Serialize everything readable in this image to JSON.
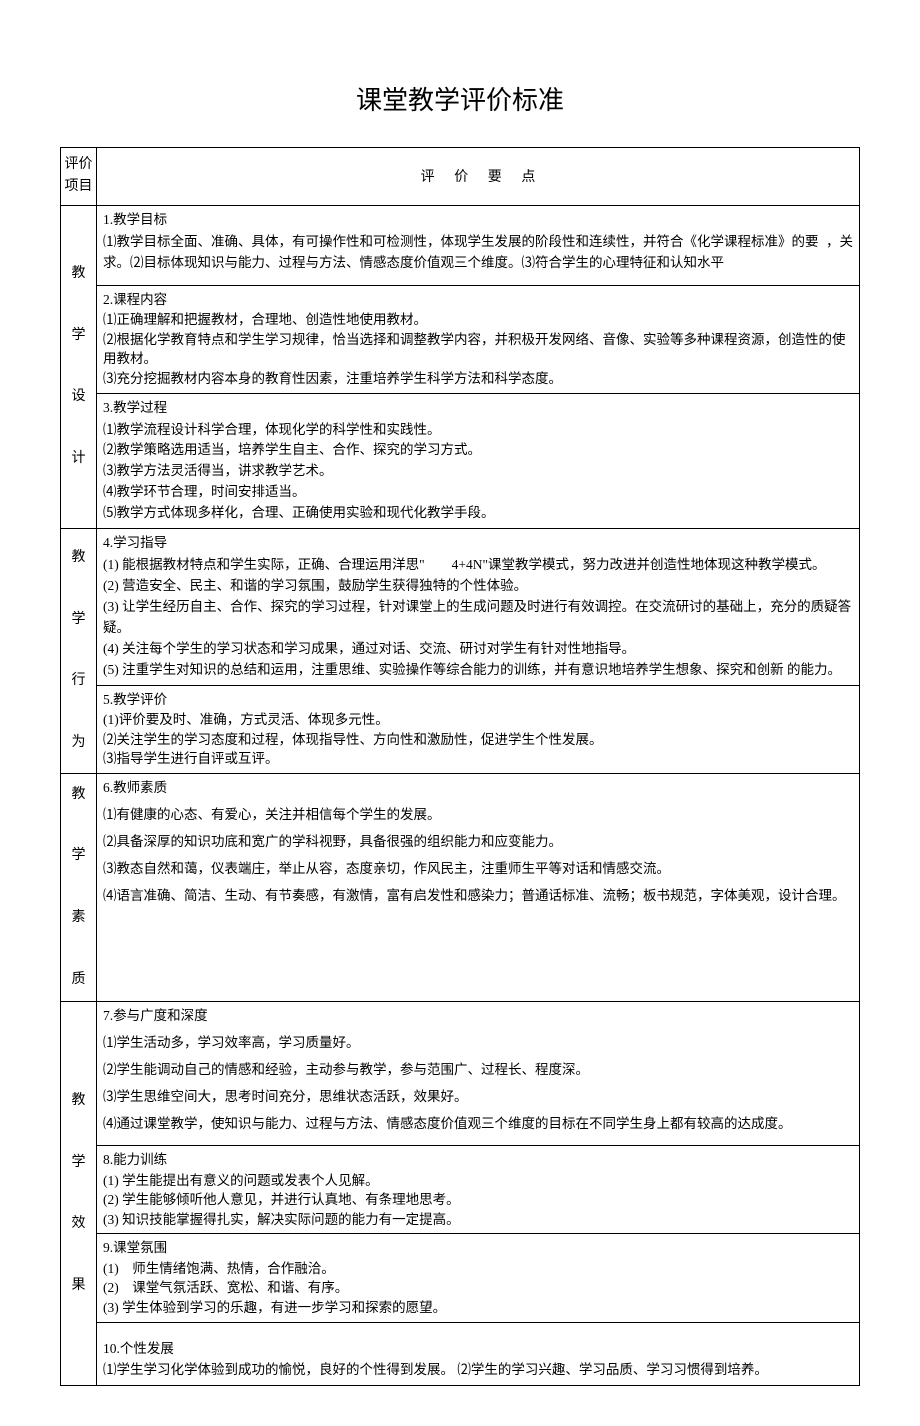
{
  "title": "课堂教学评价标准",
  "header": {
    "col1": "评价\n项目",
    "col2": "评价要点"
  },
  "cells": {
    "cat1": "教\n\n学\n\n设\n\n计",
    "cat2": "教\n\n学\n\n行\n\n为",
    "cat3": "教\n\n学\n\n素\n\n质",
    "cat4": "教\n\n学\n\n效\n\n果",
    "s1_title": "1.教学目标",
    "s1_1": "⑴教学目标全面、准确、具体，有可操作性和可检测性，体现学生发展的阶段性和连续性，并符合《化学课程标准》的要求。⑵目标体现知识与能力、过程与方法、情感态度价值观三个维度。⑶符合学生的心理特征和认知水平",
    "s1_tail": "，关",
    "s2_title": "2.课程内容",
    "s2_1": "⑴正确理解和把握教材，合理地、创造性地使用教材。",
    "s2_2": "⑵根据化学教育特点和学生学习规律，恰当选择和调整教学内容，并积极开发网络、音像、实验等多种课程资源，创造性的使用教材。",
    "s2_3": "⑶充分挖掘教材内容本身的教育性因素，注重培养学生科学方法和科学态度。",
    "s3_title": "3.教学过程",
    "s3_1": "⑴教学流程设计科学合理，体现化学的科学性和实践性。",
    "s3_2": "⑵教学策略选用适当，培养学生自主、合作、探究的学习方式。",
    "s3_3": "⑶教学方法灵活得当，讲求教学艺术。",
    "s3_4": "⑷教学环节合理，时间安排适当。",
    "s3_5": "⑸教学方式体现多样化，合理、正确使用实验和现代化教学手段。",
    "s4_title": "4.学习指导",
    "s4_1": "(1) 能根据教材特点和学生实际，正确、合理运用洋思\"　　4+4N\"课堂教学模式，努力改进并创造性地体现这种教学模式。",
    "s4_2": "(2) 营造安全、民主、和谐的学习氛围，鼓励学生获得独特的个性体验。",
    "s4_3": "(3) 让学生经历自主、合作、探究的学习过程，针对课堂上的生成问题及时进行有效调控。在交流研讨的基础上，充分的质疑答疑。",
    "s4_4": "(4) 关注每个学生的学习状态和学习成果，通过对话、交流、研讨对学生有针对性地指导。",
    "s4_5": "(5) 注重学生对知识的总结和运用，注重思维、实验操作等综合能力的训练，并有意识地培养学生想象、探究和创新 的能力。",
    "s5_title": "5.教学评价",
    "s5_1": "(1)评价要及时、准确，方式灵活、体现多元性。",
    "s5_2": "⑵关注学生的学习态度和过程，体现指导性、方向性和激励性，促进学生个性发展。",
    "s5_3": "⑶指导学生进行自评或互评。",
    "s6_title": "6.教师素质",
    "s6_1": "⑴有健康的心态、有爱心，关注并相信每个学生的发展。",
    "s6_2": "⑵具备深厚的知识功底和宽广的学科视野，具备很强的组织能力和应变能力。",
    "s6_3": "⑶教态自然和蔼，仪表端庄，举止从容，态度亲切，作风民主，注重师生平等对话和情感交流。",
    "s6_4": "⑷语言准确、简洁、生动、有节奏感，有激情，富有启发性和感染力；普通话标准、流畅；板书规范，字体美观，设计合理。",
    "s7_title": "7.参与广度和深度",
    "s7_1": "⑴学生活动多，学习效率高，学习质量好。",
    "s7_2": "⑵学生能调动自己的情感和经验，主动参与教学，参与范围广、过程长、程度深。",
    "s7_3": "⑶学生思维空间大，思考时间充分，思维状态活跃，效果好。",
    "s7_4": "⑷通过课堂教学，使知识与能力、过程与方法、情感态度价值观三个维度的目标在不同学生身上都有较高的达成度。",
    "s8_title": "8.能力训练",
    "s8_1": "(1) 学生能提出有意义的问题或发表个人见解。",
    "s8_2": "(2) 学生能够倾听他人意见，并进行认真地、有条理地思考。",
    "s8_3": " (3) 知识技能掌握得扎实，解决实际问题的能力有一定提高。",
    "s9_title": "9.课堂氛围",
    "s9_1": "(1)　师生情绪饱满、热情，合作融洽。",
    "s9_2": "(2)　课堂气氛活跃、宽松、和谐、有序。",
    "s9_3": "(3) 学生体验到学习的乐趣，有进一步学习和探索的愿望。",
    "s10_title": "10.个性发展",
    "s10_1": "⑴学生学习化学体验到成功的愉悦，良好的个性得到发展。 ⑵学生的学习兴趣、学习品质、学习习惯得到培养。"
  }
}
